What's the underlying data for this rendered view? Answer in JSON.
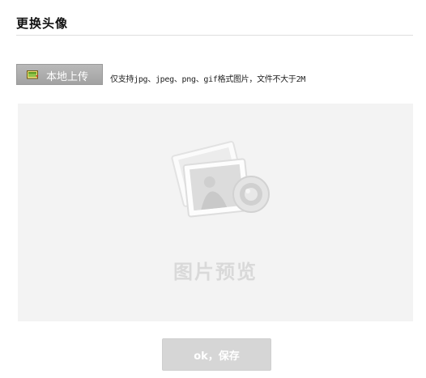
{
  "header": {
    "title": "更换头像"
  },
  "upload": {
    "button_label": "本地上传",
    "button_icon": "upload-folder-icon",
    "hint": "仅支持jpg、jpeg、png、gif格式图片，文件不大于2M"
  },
  "preview": {
    "placeholder_icon": "photo-camera-icon",
    "label": "图片预览"
  },
  "actions": {
    "save_label": "ok，保存"
  },
  "colors": {
    "preview_bg": "#f3f3f3",
    "upload_button_bg": "#a9a9a9",
    "save_button_bg": "#d6d6d6"
  }
}
